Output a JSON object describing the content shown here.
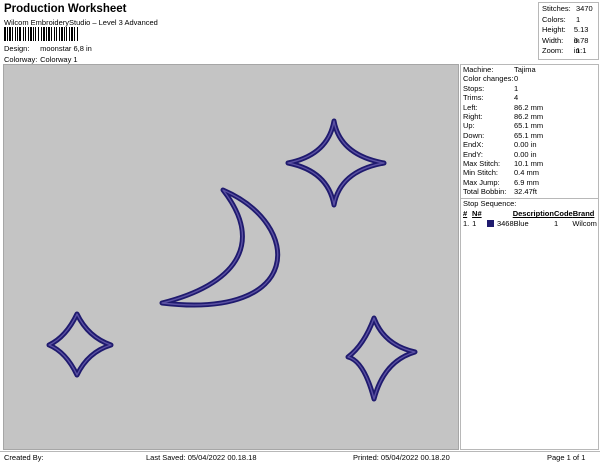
{
  "header": {
    "title": "Production Worksheet",
    "subtitle": "Wilcom EmbroideryStudio – Level 3 Advanced",
    "design_label": "Design:",
    "design_value": "moonstar 6,8 in",
    "colorway_label": "Colorway:",
    "colorway_value": "Colorway 1"
  },
  "summary": [
    {
      "k": "Stitches:",
      "v": "3470"
    },
    {
      "k": "Colors:",
      "v": "1"
    },
    {
      "k": "Height:",
      "v": "5.13 in"
    },
    {
      "k": "Width:",
      "v": "6.78 in"
    },
    {
      "k": "Zoom:",
      "v": "1:1"
    }
  ],
  "machine_info": [
    {
      "k": "Machine:",
      "v": "Tajima"
    },
    {
      "k": "Color changes:",
      "v": "0"
    },
    {
      "k": "Stops:",
      "v": "1"
    },
    {
      "k": "Trims:",
      "v": "4"
    },
    {
      "k": "Left:",
      "v": "86.2 mm"
    },
    {
      "k": "Right:",
      "v": "86.2 mm"
    },
    {
      "k": "Up:",
      "v": "65.1 mm"
    },
    {
      "k": "Down:",
      "v": "65.1 mm"
    },
    {
      "k": "EndX:",
      "v": "0.00 in"
    },
    {
      "k": "EndY:",
      "v": "0.00 in"
    },
    {
      "k": "Max Stitch:",
      "v": "10.1 mm"
    },
    {
      "k": "Min Stitch:",
      "v": "0.4 mm"
    },
    {
      "k": "Max Jump:",
      "v": "6.9 mm"
    },
    {
      "k": "Total Bobbin:",
      "v": "32.47ft"
    }
  ],
  "stop_sequence": {
    "title": "Stop Sequence:",
    "headers": [
      "#",
      "N#",
      "",
      "Description",
      "Code",
      "Brand"
    ],
    "rows": [
      {
        "n": "1.",
        "num": "1",
        "code": "3468",
        "desc": "Blue",
        "code2": "1",
        "brand": "Wilcom",
        "color": "#1f1a6e"
      }
    ]
  },
  "footer": {
    "created": "Created By:",
    "saved": "Last Saved: 05/04/2022 00.18.18",
    "printed": "Printed: 05/04/2022 00.18.20",
    "page": "Page 1 of 1"
  },
  "colors": {
    "thread": "#1f1a6e",
    "thread_highlight": "#6a5fb0",
    "canvas_bg": "#c4c4c4"
  }
}
